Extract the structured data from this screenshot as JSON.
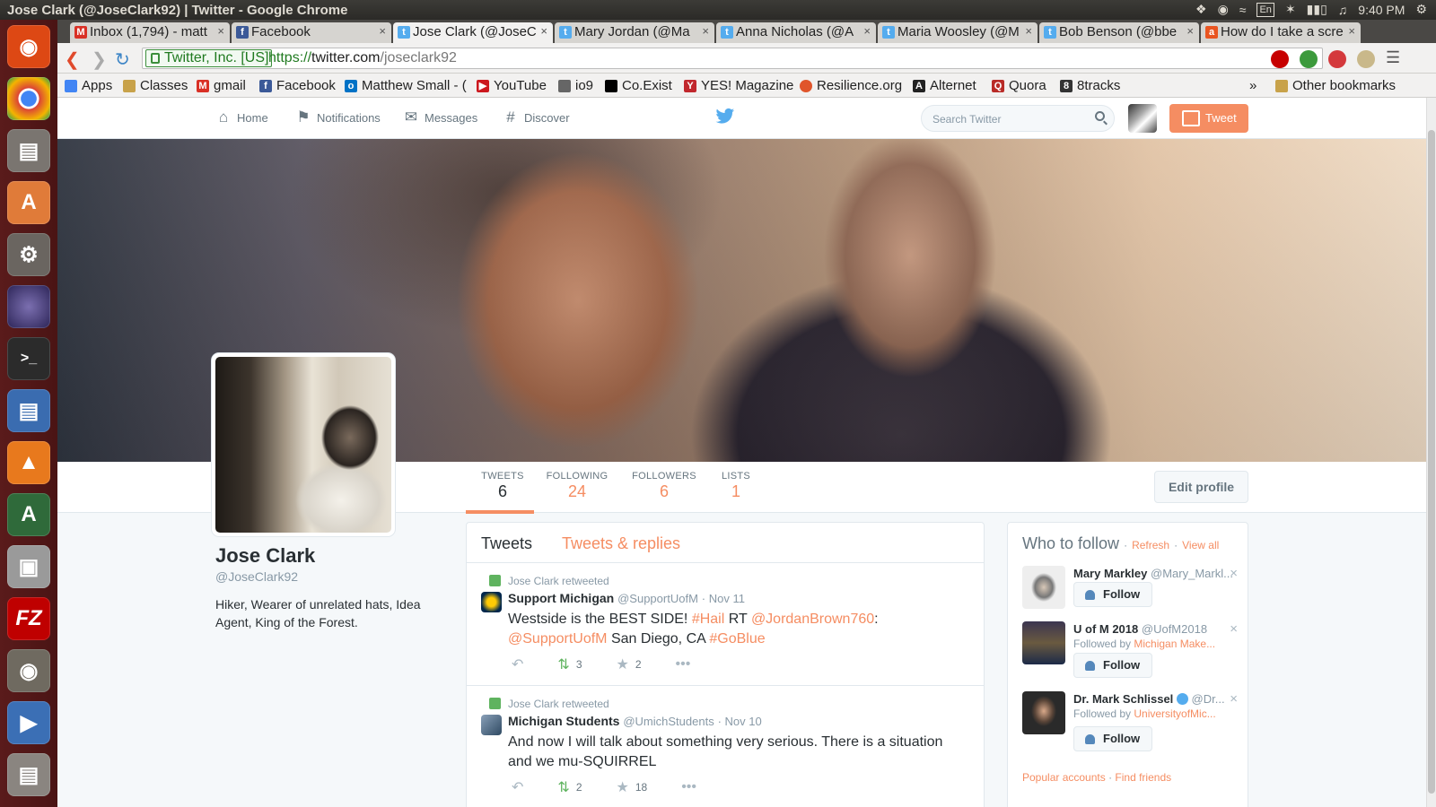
{
  "os": {
    "window_title": "Jose Clark (@JoseClark92) | Twitter - Google Chrome",
    "clock": "9:40 PM",
    "keyboard": "En"
  },
  "browser": {
    "tabs": [
      {
        "label": "Inbox (1,794) - matt",
        "icon": "gmail-icon",
        "color": "#d93025",
        "active": false
      },
      {
        "label": "Facebook",
        "icon": "facebook-icon",
        "color": "#3b5998",
        "active": false
      },
      {
        "label": "Jose Clark (@JoseC",
        "icon": "twitter-icon",
        "color": "#55acee",
        "active": true
      },
      {
        "label": "Mary Jordan (@Ma",
        "icon": "twitter-icon",
        "color": "#55acee",
        "active": false
      },
      {
        "label": "Anna Nicholas (@A",
        "icon": "twitter-icon",
        "color": "#55acee",
        "active": false
      },
      {
        "label": "Maria Woosley (@M",
        "icon": "twitter-icon",
        "color": "#55acee",
        "active": false
      },
      {
        "label": "Bob Benson (@bbe",
        "icon": "twitter-icon",
        "color": "#55acee",
        "active": false
      },
      {
        "label": "How do I take a scre",
        "icon": "askubuntu-icon",
        "color": "#e95420",
        "active": false
      }
    ],
    "ev_cert": "Twitter, Inc. [US]",
    "url_scheme": "https://",
    "url_host": "twitter.com",
    "url_path": "/joseclark92",
    "bookmarks": [
      {
        "label": "Apps",
        "icon": "apps-icon",
        "color": "#4285f4"
      },
      {
        "label": "Classes",
        "icon": "folder-icon",
        "color": "#c8a24a"
      },
      {
        "label": "gmail",
        "icon": "gmail-icon",
        "color": "#d93025"
      },
      {
        "label": "Facebook",
        "icon": "facebook-icon",
        "color": "#3b5998"
      },
      {
        "label": "Matthew Small - (",
        "icon": "outlook-icon",
        "color": "#0072c6"
      },
      {
        "label": "YouTube",
        "icon": "youtube-icon",
        "color": "#cc181e"
      },
      {
        "label": "io9",
        "icon": "io9-icon",
        "color": "#666"
      },
      {
        "label": "Co.Exist",
        "icon": "coexist-icon",
        "color": "#000"
      },
      {
        "label": "YES! Magazine",
        "icon": "yes-icon",
        "color": "#c1272d"
      },
      {
        "label": "Resilience.org",
        "icon": "resilience-icon",
        "color": "#e0552b"
      },
      {
        "label": "Alternet",
        "icon": "alternet-icon",
        "color": "#222"
      },
      {
        "label": "Quora",
        "icon": "quora-icon",
        "color": "#b92b27"
      },
      {
        "label": "8tracks",
        "icon": "8tracks-icon",
        "color": "#333"
      }
    ],
    "bookmarks_overflow": "»",
    "other_bookmarks": "Other bookmarks"
  },
  "twitter": {
    "nav": {
      "home": "Home",
      "notifications": "Notifications",
      "messages": "Messages",
      "discover": "Discover"
    },
    "search_placeholder": "Search Twitter",
    "tweet_button": "Tweet",
    "profile": {
      "name": "Jose Clark",
      "handle": "@JoseClark92",
      "bio": "Hiker, Wearer of unrelated hats, Idea Agent, King of the Forest."
    },
    "stats": [
      {
        "label": "TWEETS",
        "value": "6"
      },
      {
        "label": "FOLLOWING",
        "value": "24"
      },
      {
        "label": "FOLLOWERS",
        "value": "6"
      },
      {
        "label": "LISTS",
        "value": "1"
      }
    ],
    "edit_profile": "Edit profile",
    "timeline_tabs": {
      "tweets": "Tweets",
      "replies": "Tweets & replies"
    },
    "tweets": [
      {
        "retweeted_by": "Jose Clark retweeted",
        "author": "Support Michigan",
        "handle": "@SupportUofM",
        "date": "· Nov 11",
        "text_1": "Westside is the BEST SIDE! ",
        "tag_1": "#Hail",
        "text_2": " RT ",
        "mention_1": "@JordanBrown760",
        "text_3": ": ",
        "mention_2": "@SupportUofM",
        "text_4": " San Diego, CA ",
        "tag_2": "#GoBlue",
        "retweets": "3",
        "favorites": "2"
      },
      {
        "retweeted_by": "Jose Clark retweeted",
        "author": "Michigan Students",
        "handle": "@UmichStudents",
        "date": "· Nov 10",
        "text": "And now I will talk about something very serious. There is a situation and we mu-SQUIRREL",
        "retweets": "2",
        "favorites": "18"
      }
    ],
    "who_to_follow": {
      "title": "Who to follow",
      "refresh": "Refresh",
      "view_all": "View all",
      "follow_label": "Follow",
      "suggestions": [
        {
          "name": "Mary Markley",
          "handle": "@Mary_Markl...",
          "followed_by": "",
          "followed_by_who": ""
        },
        {
          "name": "U of M 2018",
          "handle": "@UofM2018",
          "followed_by": "Followed by ",
          "followed_by_who": "Michigan Make..."
        },
        {
          "name": "Dr. Mark Schlissel",
          "handle": "@Dr...",
          "followed_by": "Followed by ",
          "followed_by_who": "UniversityofMic..."
        }
      ],
      "popular": "Popular accounts",
      "find_friends": "Find friends"
    }
  }
}
